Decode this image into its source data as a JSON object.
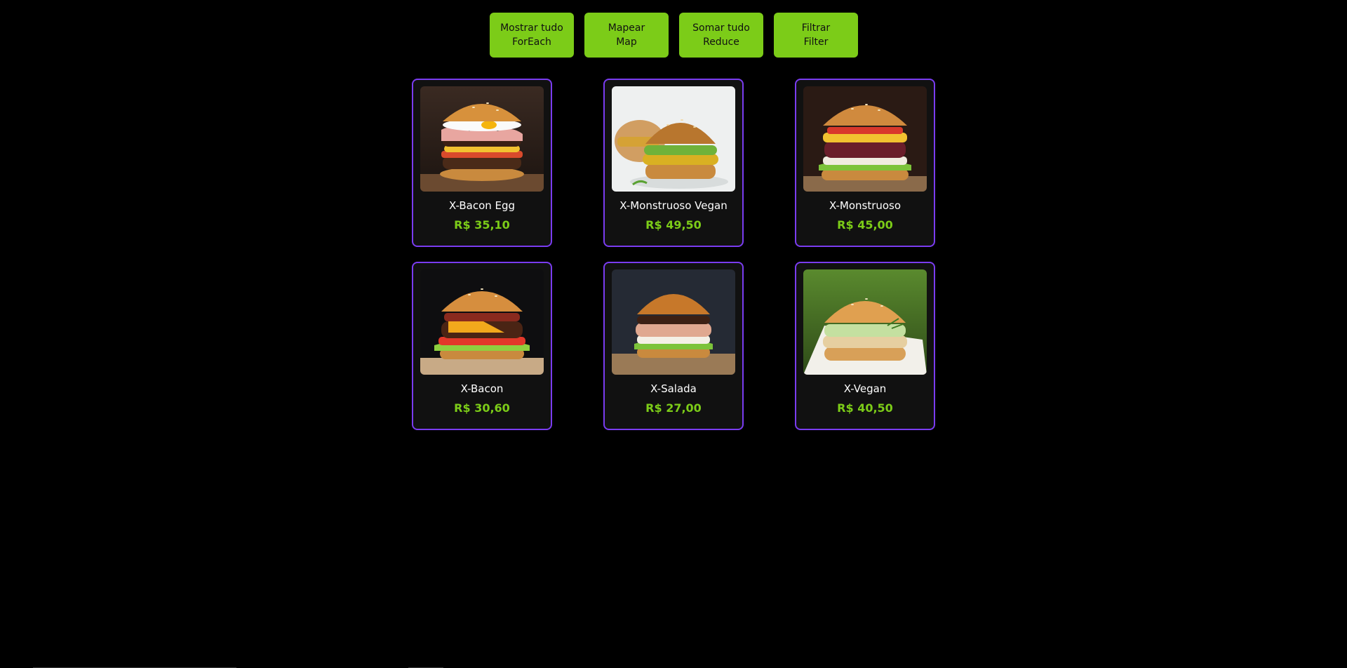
{
  "toolbar": {
    "buttons": [
      {
        "line1": "Mostrar tudo",
        "line2": "ForEach"
      },
      {
        "line1": "Mapear",
        "line2": "Map"
      },
      {
        "line1": "Somar tudo",
        "line2": "Reduce"
      },
      {
        "line1": "Filtrar",
        "line2": "Filter"
      }
    ]
  },
  "products": [
    {
      "name": "X-Bacon Egg",
      "price": "R$ 35,10",
      "photo": "burger-bacon-egg"
    },
    {
      "name": "X-Monstruoso Vegan",
      "price": "R$ 49,50",
      "photo": "burger-monstruoso-vegan"
    },
    {
      "name": "X-Monstruoso",
      "price": "R$ 45,00",
      "photo": "burger-monstruoso"
    },
    {
      "name": "X-Bacon",
      "price": "R$ 30,60",
      "photo": "burger-bacon"
    },
    {
      "name": "X-Salada",
      "price": "R$ 27,00",
      "photo": "burger-salada"
    },
    {
      "name": "X-Vegan",
      "price": "R$ 40,50",
      "photo": "burger-vegan"
    }
  ],
  "colors": {
    "accent": "#7ccc18",
    "card_border": "#7a3cf0",
    "background": "#000000",
    "card_background": "#111111"
  }
}
